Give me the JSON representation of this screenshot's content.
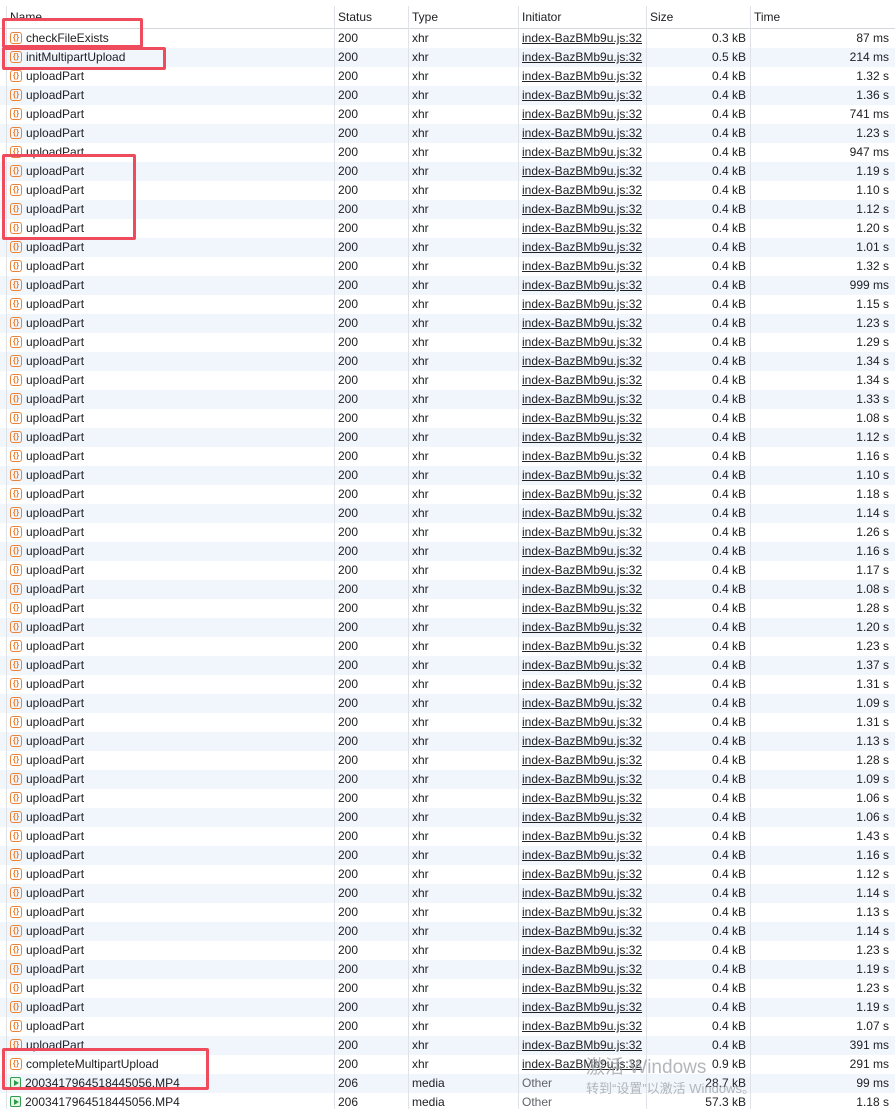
{
  "columns": {
    "name": "Name",
    "status": "Status",
    "type": "Type",
    "initiator": "Initiator",
    "size": "Size",
    "time": "Time"
  },
  "rows": [
    {
      "name": "checkFileExists",
      "status": "200",
      "type": "xhr",
      "initiator": "index-BazBMb9u.js:32",
      "size": "0.3 kB",
      "time": "87 ms",
      "icon": "xhr-icon"
    },
    {
      "name": "initMultipartUpload",
      "status": "200",
      "type": "xhr",
      "initiator": "index-BazBMb9u.js:32",
      "size": "0.5 kB",
      "time": "214 ms",
      "icon": "xhr-icon"
    },
    {
      "name": "uploadPart",
      "status": "200",
      "type": "xhr",
      "initiator": "index-BazBMb9u.js:32",
      "size": "0.4 kB",
      "time": "1.32 s",
      "icon": "xhr-icon"
    },
    {
      "name": "uploadPart",
      "status": "200",
      "type": "xhr",
      "initiator": "index-BazBMb9u.js:32",
      "size": "0.4 kB",
      "time": "1.36 s",
      "icon": "xhr-icon"
    },
    {
      "name": "uploadPart",
      "status": "200",
      "type": "xhr",
      "initiator": "index-BazBMb9u.js:32",
      "size": "0.4 kB",
      "time": "741 ms",
      "icon": "xhr-icon"
    },
    {
      "name": "uploadPart",
      "status": "200",
      "type": "xhr",
      "initiator": "index-BazBMb9u.js:32",
      "size": "0.4 kB",
      "time": "1.23 s",
      "icon": "xhr-icon"
    },
    {
      "name": "uploadPart",
      "status": "200",
      "type": "xhr",
      "initiator": "index-BazBMb9u.js:32",
      "size": "0.4 kB",
      "time": "947 ms",
      "icon": "xhr-icon"
    },
    {
      "name": "uploadPart",
      "status": "200",
      "type": "xhr",
      "initiator": "index-BazBMb9u.js:32",
      "size": "0.4 kB",
      "time": "1.19 s",
      "icon": "xhr-icon"
    },
    {
      "name": "uploadPart",
      "status": "200",
      "type": "xhr",
      "initiator": "index-BazBMb9u.js:32",
      "size": "0.4 kB",
      "time": "1.10 s",
      "icon": "xhr-icon"
    },
    {
      "name": "uploadPart",
      "status": "200",
      "type": "xhr",
      "initiator": "index-BazBMb9u.js:32",
      "size": "0.4 kB",
      "time": "1.12 s",
      "icon": "xhr-icon"
    },
    {
      "name": "uploadPart",
      "status": "200",
      "type": "xhr",
      "initiator": "index-BazBMb9u.js:32",
      "size": "0.4 kB",
      "time": "1.20 s",
      "icon": "xhr-icon"
    },
    {
      "name": "uploadPart",
      "status": "200",
      "type": "xhr",
      "initiator": "index-BazBMb9u.js:32",
      "size": "0.4 kB",
      "time": "1.01 s",
      "icon": "xhr-icon"
    },
    {
      "name": "uploadPart",
      "status": "200",
      "type": "xhr",
      "initiator": "index-BazBMb9u.js:32",
      "size": "0.4 kB",
      "time": "1.32 s",
      "icon": "xhr-icon"
    },
    {
      "name": "uploadPart",
      "status": "200",
      "type": "xhr",
      "initiator": "index-BazBMb9u.js:32",
      "size": "0.4 kB",
      "time": "999 ms",
      "icon": "xhr-icon"
    },
    {
      "name": "uploadPart",
      "status": "200",
      "type": "xhr",
      "initiator": "index-BazBMb9u.js:32",
      "size": "0.4 kB",
      "time": "1.15 s",
      "icon": "xhr-icon"
    },
    {
      "name": "uploadPart",
      "status": "200",
      "type": "xhr",
      "initiator": "index-BazBMb9u.js:32",
      "size": "0.4 kB",
      "time": "1.23 s",
      "icon": "xhr-icon"
    },
    {
      "name": "uploadPart",
      "status": "200",
      "type": "xhr",
      "initiator": "index-BazBMb9u.js:32",
      "size": "0.4 kB",
      "time": "1.29 s",
      "icon": "xhr-icon"
    },
    {
      "name": "uploadPart",
      "status": "200",
      "type": "xhr",
      "initiator": "index-BazBMb9u.js:32",
      "size": "0.4 kB",
      "time": "1.34 s",
      "icon": "xhr-icon"
    },
    {
      "name": "uploadPart",
      "status": "200",
      "type": "xhr",
      "initiator": "index-BazBMb9u.js:32",
      "size": "0.4 kB",
      "time": "1.34 s",
      "icon": "xhr-icon"
    },
    {
      "name": "uploadPart",
      "status": "200",
      "type": "xhr",
      "initiator": "index-BazBMb9u.js:32",
      "size": "0.4 kB",
      "time": "1.33 s",
      "icon": "xhr-icon"
    },
    {
      "name": "uploadPart",
      "status": "200",
      "type": "xhr",
      "initiator": "index-BazBMb9u.js:32",
      "size": "0.4 kB",
      "time": "1.08 s",
      "icon": "xhr-icon"
    },
    {
      "name": "uploadPart",
      "status": "200",
      "type": "xhr",
      "initiator": "index-BazBMb9u.js:32",
      "size": "0.4 kB",
      "time": "1.12 s",
      "icon": "xhr-icon"
    },
    {
      "name": "uploadPart",
      "status": "200",
      "type": "xhr",
      "initiator": "index-BazBMb9u.js:32",
      "size": "0.4 kB",
      "time": "1.16 s",
      "icon": "xhr-icon"
    },
    {
      "name": "uploadPart",
      "status": "200",
      "type": "xhr",
      "initiator": "index-BazBMb9u.js:32",
      "size": "0.4 kB",
      "time": "1.10 s",
      "icon": "xhr-icon"
    },
    {
      "name": "uploadPart",
      "status": "200",
      "type": "xhr",
      "initiator": "index-BazBMb9u.js:32",
      "size": "0.4 kB",
      "time": "1.18 s",
      "icon": "xhr-icon"
    },
    {
      "name": "uploadPart",
      "status": "200",
      "type": "xhr",
      "initiator": "index-BazBMb9u.js:32",
      "size": "0.4 kB",
      "time": "1.14 s",
      "icon": "xhr-icon"
    },
    {
      "name": "uploadPart",
      "status": "200",
      "type": "xhr",
      "initiator": "index-BazBMb9u.js:32",
      "size": "0.4 kB",
      "time": "1.26 s",
      "icon": "xhr-icon"
    },
    {
      "name": "uploadPart",
      "status": "200",
      "type": "xhr",
      "initiator": "index-BazBMb9u.js:32",
      "size": "0.4 kB",
      "time": "1.16 s",
      "icon": "xhr-icon"
    },
    {
      "name": "uploadPart",
      "status": "200",
      "type": "xhr",
      "initiator": "index-BazBMb9u.js:32",
      "size": "0.4 kB",
      "time": "1.17 s",
      "icon": "xhr-icon"
    },
    {
      "name": "uploadPart",
      "status": "200",
      "type": "xhr",
      "initiator": "index-BazBMb9u.js:32",
      "size": "0.4 kB",
      "time": "1.08 s",
      "icon": "xhr-icon"
    },
    {
      "name": "uploadPart",
      "status": "200",
      "type": "xhr",
      "initiator": "index-BazBMb9u.js:32",
      "size": "0.4 kB",
      "time": "1.28 s",
      "icon": "xhr-icon"
    },
    {
      "name": "uploadPart",
      "status": "200",
      "type": "xhr",
      "initiator": "index-BazBMb9u.js:32",
      "size": "0.4 kB",
      "time": "1.20 s",
      "icon": "xhr-icon"
    },
    {
      "name": "uploadPart",
      "status": "200",
      "type": "xhr",
      "initiator": "index-BazBMb9u.js:32",
      "size": "0.4 kB",
      "time": "1.23 s",
      "icon": "xhr-icon"
    },
    {
      "name": "uploadPart",
      "status": "200",
      "type": "xhr",
      "initiator": "index-BazBMb9u.js:32",
      "size": "0.4 kB",
      "time": "1.37 s",
      "icon": "xhr-icon"
    },
    {
      "name": "uploadPart",
      "status": "200",
      "type": "xhr",
      "initiator": "index-BazBMb9u.js:32",
      "size": "0.4 kB",
      "time": "1.31 s",
      "icon": "xhr-icon"
    },
    {
      "name": "uploadPart",
      "status": "200",
      "type": "xhr",
      "initiator": "index-BazBMb9u.js:32",
      "size": "0.4 kB",
      "time": "1.09 s",
      "icon": "xhr-icon"
    },
    {
      "name": "uploadPart",
      "status": "200",
      "type": "xhr",
      "initiator": "index-BazBMb9u.js:32",
      "size": "0.4 kB",
      "time": "1.31 s",
      "icon": "xhr-icon"
    },
    {
      "name": "uploadPart",
      "status": "200",
      "type": "xhr",
      "initiator": "index-BazBMb9u.js:32",
      "size": "0.4 kB",
      "time": "1.13 s",
      "icon": "xhr-icon"
    },
    {
      "name": "uploadPart",
      "status": "200",
      "type": "xhr",
      "initiator": "index-BazBMb9u.js:32",
      "size": "0.4 kB",
      "time": "1.28 s",
      "icon": "xhr-icon"
    },
    {
      "name": "uploadPart",
      "status": "200",
      "type": "xhr",
      "initiator": "index-BazBMb9u.js:32",
      "size": "0.4 kB",
      "time": "1.09 s",
      "icon": "xhr-icon"
    },
    {
      "name": "uploadPart",
      "status": "200",
      "type": "xhr",
      "initiator": "index-BazBMb9u.js:32",
      "size": "0.4 kB",
      "time": "1.06 s",
      "icon": "xhr-icon"
    },
    {
      "name": "uploadPart",
      "status": "200",
      "type": "xhr",
      "initiator": "index-BazBMb9u.js:32",
      "size": "0.4 kB",
      "time": "1.06 s",
      "icon": "xhr-icon"
    },
    {
      "name": "uploadPart",
      "status": "200",
      "type": "xhr",
      "initiator": "index-BazBMb9u.js:32",
      "size": "0.4 kB",
      "time": "1.43 s",
      "icon": "xhr-icon"
    },
    {
      "name": "uploadPart",
      "status": "200",
      "type": "xhr",
      "initiator": "index-BazBMb9u.js:32",
      "size": "0.4 kB",
      "time": "1.16 s",
      "icon": "xhr-icon"
    },
    {
      "name": "uploadPart",
      "status": "200",
      "type": "xhr",
      "initiator": "index-BazBMb9u.js:32",
      "size": "0.4 kB",
      "time": "1.12 s",
      "icon": "xhr-icon"
    },
    {
      "name": "uploadPart",
      "status": "200",
      "type": "xhr",
      "initiator": "index-BazBMb9u.js:32",
      "size": "0.4 kB",
      "time": "1.14 s",
      "icon": "xhr-icon"
    },
    {
      "name": "uploadPart",
      "status": "200",
      "type": "xhr",
      "initiator": "index-BazBMb9u.js:32",
      "size": "0.4 kB",
      "time": "1.13 s",
      "icon": "xhr-icon"
    },
    {
      "name": "uploadPart",
      "status": "200",
      "type": "xhr",
      "initiator": "index-BazBMb9u.js:32",
      "size": "0.4 kB",
      "time": "1.14 s",
      "icon": "xhr-icon"
    },
    {
      "name": "uploadPart",
      "status": "200",
      "type": "xhr",
      "initiator": "index-BazBMb9u.js:32",
      "size": "0.4 kB",
      "time": "1.23 s",
      "icon": "xhr-icon"
    },
    {
      "name": "uploadPart",
      "status": "200",
      "type": "xhr",
      "initiator": "index-BazBMb9u.js:32",
      "size": "0.4 kB",
      "time": "1.19 s",
      "icon": "xhr-icon"
    },
    {
      "name": "uploadPart",
      "status": "200",
      "type": "xhr",
      "initiator": "index-BazBMb9u.js:32",
      "size": "0.4 kB",
      "time": "1.23 s",
      "icon": "xhr-icon"
    },
    {
      "name": "uploadPart",
      "status": "200",
      "type": "xhr",
      "initiator": "index-BazBMb9u.js:32",
      "size": "0.4 kB",
      "time": "1.19 s",
      "icon": "xhr-icon"
    },
    {
      "name": "uploadPart",
      "status": "200",
      "type": "xhr",
      "initiator": "index-BazBMb9u.js:32",
      "size": "0.4 kB",
      "time": "1.07 s",
      "icon": "xhr-icon"
    },
    {
      "name": "uploadPart",
      "status": "200",
      "type": "xhr",
      "initiator": "index-BazBMb9u.js:32",
      "size": "0.4 kB",
      "time": "391 ms",
      "icon": "xhr-icon"
    },
    {
      "name": "completeMultipartUpload",
      "status": "200",
      "type": "xhr",
      "initiator": "index-BazBMb9u.js:32",
      "size": "0.9 kB",
      "time": "291 ms",
      "icon": "xhr-icon"
    },
    {
      "name": "2003417964518445056.MP4",
      "status": "206",
      "type": "media",
      "initiator": "Other",
      "size": "28.7 kB",
      "time": "99 ms",
      "icon": "media-icon"
    },
    {
      "name": "2003417964518445056.MP4",
      "status": "206",
      "type": "media",
      "initiator": "Other",
      "size": "57.3 kB",
      "time": "1.18 s",
      "icon": "media-icon"
    }
  ],
  "watermark": {
    "line1": "激活 Windows",
    "line2": "转到“设置”以激活 Windows。"
  },
  "colors": {
    "highlight": "#ee4c5d",
    "row_alt": "#f1f6fd",
    "xhr_icon": "#e8833a",
    "media_icon": "#2e9c48"
  }
}
